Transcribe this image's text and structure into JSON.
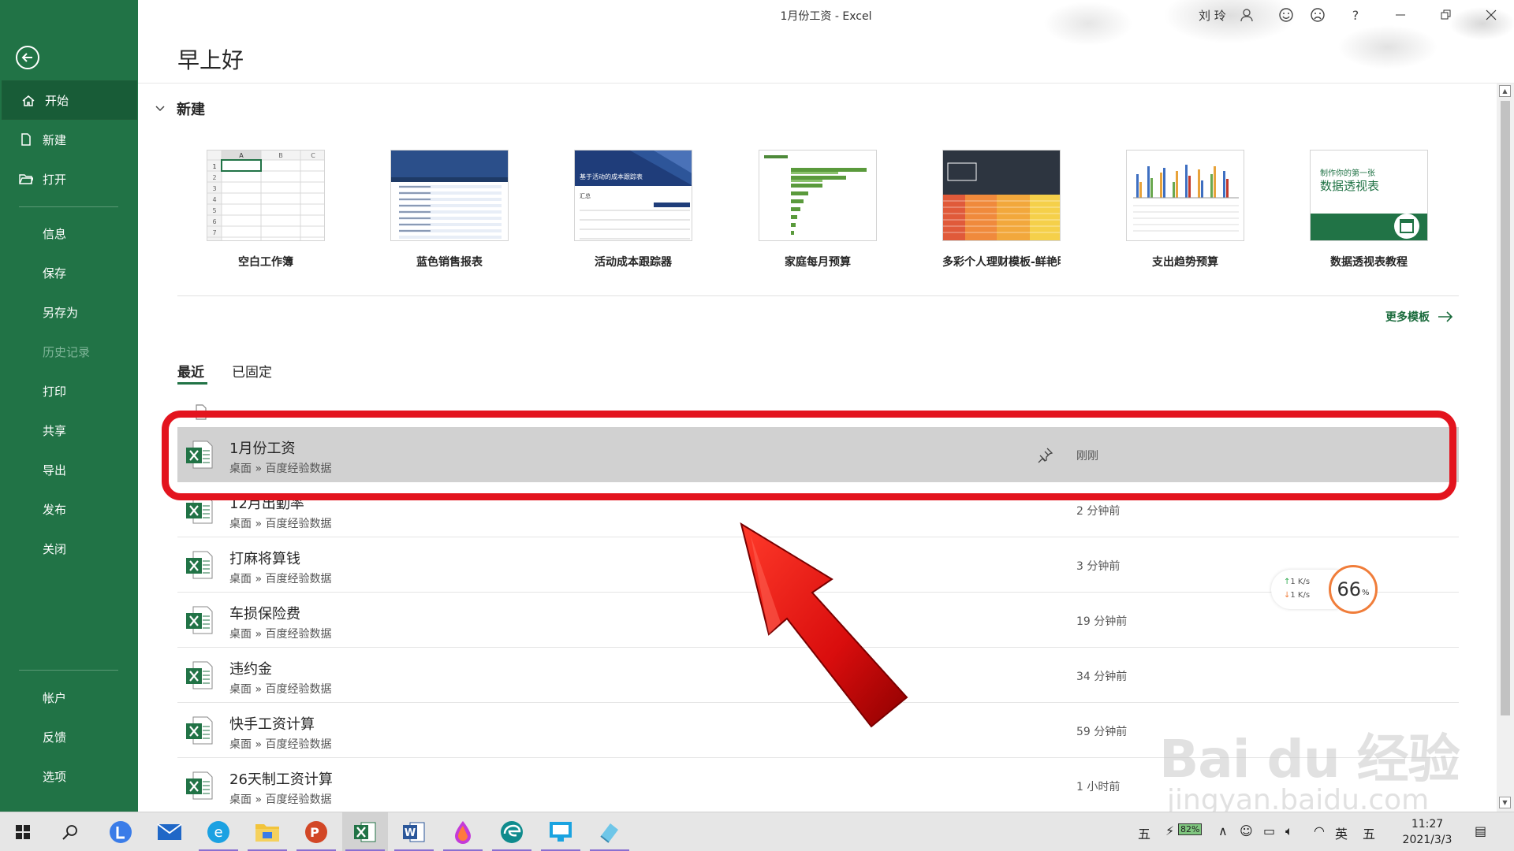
{
  "window": {
    "title": "1月份工资  -  Excel",
    "user": "刘 玲"
  },
  "greeting": "早上好",
  "sidebar": {
    "items": [
      {
        "label": "开始"
      },
      {
        "label": "新建"
      },
      {
        "label": "打开"
      },
      {
        "label": "信息"
      },
      {
        "label": "保存"
      },
      {
        "label": "另存为"
      },
      {
        "label": "历史记录"
      },
      {
        "label": "打印"
      },
      {
        "label": "共享"
      },
      {
        "label": "导出"
      },
      {
        "label": "发布"
      },
      {
        "label": "关闭"
      },
      {
        "label": "帐户"
      },
      {
        "label": "反馈"
      },
      {
        "label": "选项"
      }
    ]
  },
  "new_section": {
    "title": "新建",
    "more_label": "更多模板",
    "templates": [
      {
        "label": "空白工作簿",
        "grid_cols": [
          "A",
          "B",
          "C"
        ],
        "grid_rows": [
          "1",
          "2",
          "3",
          "4",
          "5",
          "6",
          "7"
        ]
      },
      {
        "label": "蓝色销售报表"
      },
      {
        "label": "活动成本跟踪器",
        "thumb_title": "基于活动的成本跟踪表",
        "thumb_sub": "汇总"
      },
      {
        "label": "家庭每月预算"
      },
      {
        "label": "多彩个人理财模板-鲜艳明..."
      },
      {
        "label": "支出趋势预算"
      },
      {
        "label": "数据透视表教程",
        "thumb_line1": "制作你的第一张",
        "thumb_line2": "数据透视表"
      }
    ]
  },
  "tabs": [
    {
      "label": "最近"
    },
    {
      "label": "已固定"
    }
  ],
  "recent_files": [
    {
      "name": "1月份工资",
      "path": "桌面 » 百度经验数据",
      "time": "刚刚"
    },
    {
      "name": "12月出勤率",
      "path": "桌面 » 百度经验数据",
      "time": "2 分钟前"
    },
    {
      "name": "打麻将算钱",
      "path": "桌面 » 百度经验数据",
      "time": "3 分钟前"
    },
    {
      "name": "车损保险费",
      "path": "桌面 » 百度经验数据",
      "time": "19 分钟前"
    },
    {
      "name": "违约金",
      "path": "桌面 » 百度经验数据",
      "time": "34 分钟前"
    },
    {
      "name": "快手工资计算",
      "path": "桌面 » 百度经验数据",
      "time": "59 分钟前"
    },
    {
      "name": "26天制工资计算",
      "path": "桌面 » 百度经验数据",
      "time": "1 小时前"
    }
  ],
  "net_widget": {
    "up": "1  K/s",
    "down": "1  K/s",
    "percent": "66",
    "percent_unit": "%"
  },
  "watermark": {
    "main": "Bai du 经验",
    "sub": "jingyan.baidu.com"
  },
  "tray": {
    "ime1": "五",
    "battery": "82%",
    "lang": "英",
    "ime2": "五",
    "time": "11:27",
    "date": "2021/3/3"
  },
  "colors": {
    "brand": "#217346",
    "annotation": "#e3141e"
  }
}
